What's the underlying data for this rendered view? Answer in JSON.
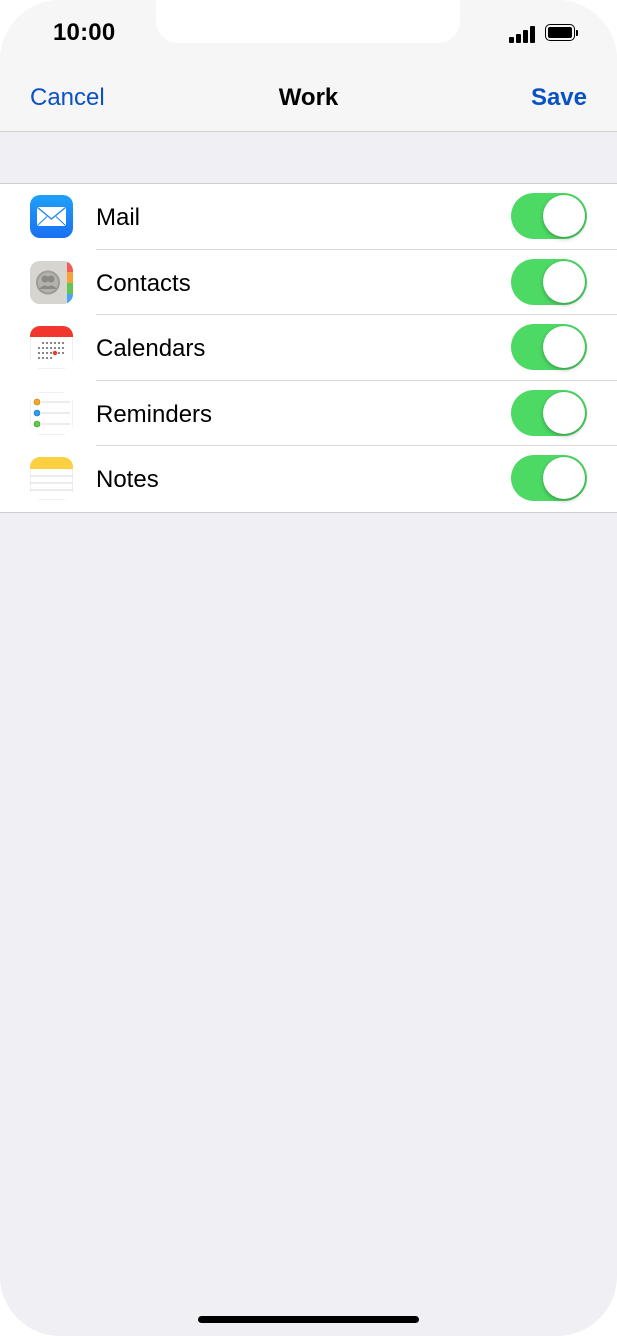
{
  "status_bar": {
    "time": "10:00",
    "signal_icon": "cellular-signal-icon",
    "battery_icon": "battery-icon"
  },
  "nav": {
    "cancel_label": "Cancel",
    "title": "Work",
    "save_label": "Save",
    "accent_color": "#0a52c4"
  },
  "accounts": {
    "items": [
      {
        "label": "Mail",
        "icon": "mail-icon",
        "enabled": true
      },
      {
        "label": "Contacts",
        "icon": "contacts-icon",
        "enabled": true
      },
      {
        "label": "Calendars",
        "icon": "calendar-icon",
        "enabled": true
      },
      {
        "label": "Reminders",
        "icon": "reminders-icon",
        "enabled": true
      },
      {
        "label": "Notes",
        "icon": "notes-icon",
        "enabled": true
      }
    ],
    "toggle_on_color": "#4cd964"
  }
}
